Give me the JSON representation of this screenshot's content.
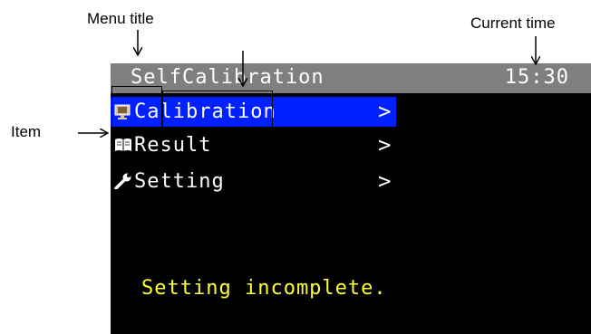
{
  "annotations": {
    "menu_title": "Menu title",
    "current_time": "Current time",
    "item": "Item"
  },
  "header": {
    "title": "SelfCalibration",
    "time": "15:30"
  },
  "menu": {
    "items": [
      {
        "label": "Calibration",
        "icon": "calibration-icon",
        "chevron": ">",
        "selected": true
      },
      {
        "label": "Result",
        "icon": "book-icon",
        "chevron": ">",
        "selected": false
      },
      {
        "label": "Setting",
        "icon": "wrench-icon",
        "chevron": ">",
        "selected": false
      }
    ]
  },
  "status": {
    "message": "Setting incomplete."
  },
  "colors": {
    "titlebar": "#7f7f7f",
    "selection": "#0020ff",
    "status_text": "#ffff30",
    "screen_bg": "#000000"
  }
}
